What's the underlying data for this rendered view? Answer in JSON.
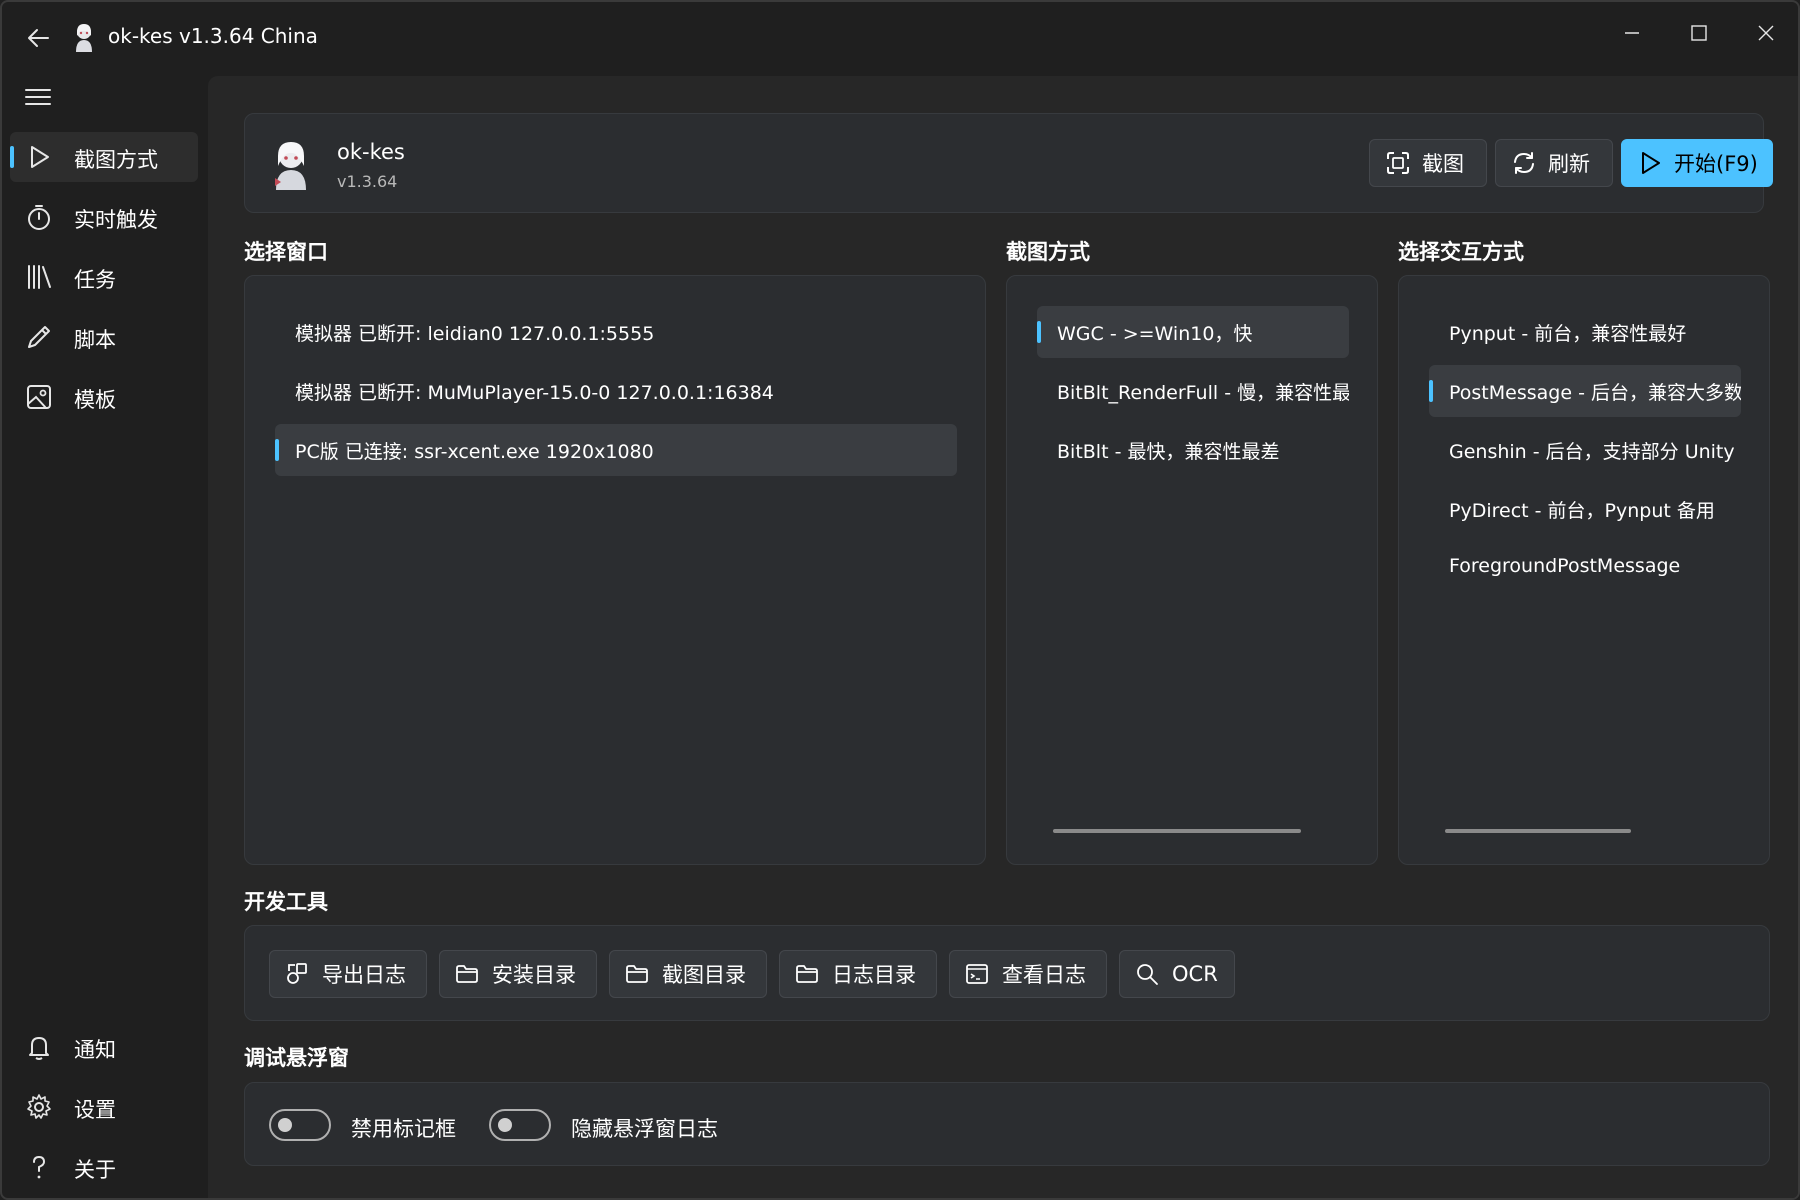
{
  "window": {
    "title": "ok-kes v1.3.64 China"
  },
  "sidebar": {
    "items": [
      {
        "label": "截图方式",
        "icon": "play-icon"
      },
      {
        "label": "实时触发",
        "icon": "timer-icon"
      },
      {
        "label": "任务",
        "icon": "library-icon"
      },
      {
        "label": "脚本",
        "icon": "pencil-icon"
      },
      {
        "label": "模板",
        "icon": "image-icon"
      }
    ],
    "bottom_items": [
      {
        "label": "通知",
        "icon": "bell-icon"
      },
      {
        "label": "设置",
        "icon": "gear-icon"
      },
      {
        "label": "关于",
        "icon": "question-icon"
      }
    ]
  },
  "header": {
    "app_name": "ok-kes",
    "version": "v1.3.64",
    "screenshot_label": "截图",
    "refresh_label": "刷新",
    "start_label": "开始(F9)"
  },
  "sections": {
    "select_window": "选择窗口",
    "capture_method": "截图方式",
    "interaction": "选择交互方式",
    "dev_tools": "开发工具",
    "debug_float": "调试悬浮窗"
  },
  "windows_list": [
    "模拟器 已断开: leidian0 127.0.0.1:5555",
    "模拟器 已断开: MuMuPlayer-15.0-0 127.0.0.1:16384",
    "PC版 已连接: ssr-xcent.exe  1920x1080"
  ],
  "capture_list": [
    "WGC - >=Win10，快",
    "BitBlt_RenderFull - 慢，兼容性最好",
    "BitBlt - 最快，兼容性最差"
  ],
  "interaction_list": [
    "Pynput - 前台，兼容性最好",
    "PostMessage - 后台，兼容大多数",
    "Genshin - 后台，支持部分 Unity 游戏",
    "PyDirect - 前台，Pynput 备用",
    "ForegroundPostMessage"
  ],
  "dev_tools": [
    {
      "label": "导出日志",
      "icon": "export-log-icon"
    },
    {
      "label": "安装目录",
      "icon": "folder-icon"
    },
    {
      "label": "截图目录",
      "icon": "folder-icon"
    },
    {
      "label": "日志目录",
      "icon": "folder-icon"
    },
    {
      "label": "查看日志",
      "icon": "console-icon"
    },
    {
      "label": "OCR",
      "icon": "search-icon"
    }
  ],
  "debug_toggles": [
    {
      "label": "禁用标记框",
      "on": false
    },
    {
      "label": "隐藏悬浮窗日志",
      "on": false
    }
  ],
  "colors": {
    "accent": "#4cc2ff"
  }
}
